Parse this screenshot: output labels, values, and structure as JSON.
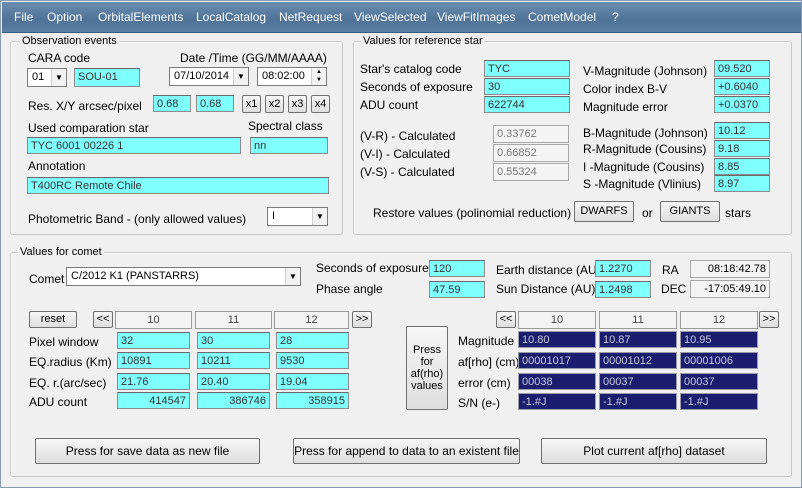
{
  "menu": [
    "File",
    "Option",
    "OrbitalElements",
    "LocalCatalog",
    "NetRequest",
    "ViewSelected",
    "ViewFitImages",
    "CometModel",
    "?"
  ],
  "obs": {
    "title": "Observation events",
    "cara_label": "CARA code",
    "cara_num": "01",
    "cara_code": "SOU-01",
    "date_label": "Date /Time  (GG/MM/AAAA)",
    "date": "07/10/2014",
    "time": "08:02:00",
    "res_label": "Res.  X/Y arcsec/pixel",
    "res_x": "0.68",
    "res_y": "0.68",
    "zoom": [
      "x1",
      "x2",
      "x3",
      "x4"
    ],
    "comp_label": "Used comparation star",
    "comp_star": "TYC 6001 00226 1",
    "spectral_label": "Spectral class",
    "spectral": "nn",
    "annotation_label": "Annotation",
    "annotation": "T400RC Remote Chile",
    "band_label": "Photometric Band  - (only allowed values)",
    "band": "I"
  },
  "ref": {
    "title": "Values for reference star",
    "cat_label": "Star's catalog code",
    "cat": "TYC",
    "exp_label": "Seconds of exposure",
    "exp": "30",
    "adu_label": "ADU count",
    "adu": "622744",
    "vr_label": "(V-R) - Calculated",
    "vr": "0.33762",
    "vi_label": "(V-I) -  Calculated",
    "vi": "0.66852",
    "vs_label": "(V-S) - Calculated",
    "vs": "0.55324",
    "vmag_label": "V-Magnitude (Johnson)",
    "vmag": "09.520",
    "bv_label": "Color index B-V",
    "bv": "+0.6040",
    "magerr_label": "Magnitude error",
    "magerr": "+0.0370",
    "bmag_label": "B-Magnitude (Johnson)",
    "bmag": "10.12",
    "rmag_label": "R-Magnitude (Cousins)",
    "rmag": "9.18",
    "imag_label": "I -Magnitude (Cousins)",
    "imag": "8.85",
    "smag_label": "S -Magnitude (Vlinius)",
    "smag": "8.97",
    "restore_label": "Restore values (polinomial reduction) for",
    "dwarfs": "DWARFS",
    "or": "or",
    "giants": "GIANTS",
    "stars": "stars"
  },
  "comet": {
    "title": "Values for comet",
    "comet_label": "Comet",
    "comet": "C/2012 K1 (PANSTARRS)",
    "exp_label": "Seconds of exposure",
    "exp": "120",
    "phase_label": "Phase angle",
    "phase": "47.59",
    "earth_label": "Earth distance (AU)",
    "earth": "1.2270",
    "sun_label": "Sun Distance (AU)",
    "sun": "1.2498",
    "ra_label": "RA",
    "ra": "08:18:42.78",
    "dec_label": "DEC",
    "dec": "-17:05:49.10",
    "reset": "reset",
    "prev": "<<",
    "next": ">>",
    "cols": [
      "10",
      "11",
      "12"
    ],
    "row_labels": [
      "Pixel window",
      "EQ.radius (Km)",
      "EQ. r.(arc/sec)",
      "ADU count"
    ],
    "pixel": [
      "32",
      "30",
      "28"
    ],
    "eq_km": [
      "10891",
      "10211",
      "9530"
    ],
    "eq_arc": [
      "21.76",
      "20.40",
      "19.04"
    ],
    "adu": [
      "414547",
      "386746",
      "358915"
    ],
    "afrho_btn": "Press\nfor\naf(rho)\nvalues",
    "res_labels": [
      "Magnitude",
      "af[rho] (cm)",
      "error (cm)",
      "S/N (e-)"
    ],
    "mag": [
      "10.80",
      "10.87",
      "10.95"
    ],
    "afrho": [
      "00001017",
      "00001012",
      "00001006"
    ],
    "err": [
      "00038",
      "00037",
      "00037"
    ],
    "sn": [
      "-1.#J",
      "-1.#J",
      "-1.#J"
    ]
  },
  "buttons": {
    "save": "Press for save data as new file",
    "append": "Press for append to  data to an existent file",
    "plot": "Plot current af[rho] dataset"
  }
}
